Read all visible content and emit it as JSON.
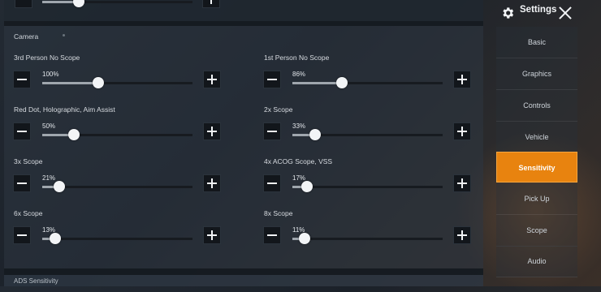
{
  "header": {
    "title": "Settings",
    "close_icon": "close-icon",
    "gear_icon": "gear-icon"
  },
  "section": {
    "title": "Camera"
  },
  "sliders": [
    {
      "label": "3rd Person No Scope",
      "value_text": "100%",
      "percent": 100
    },
    {
      "label": "1st Person No Scope",
      "value_text": "86%",
      "percent": 86
    },
    {
      "label": "Red Dot, Holographic, Aim Assist",
      "value_text": "50%",
      "percent": 50
    },
    {
      "label": "2x Scope",
      "value_text": "33%",
      "percent": 33
    },
    {
      "label": "3x Scope",
      "value_text": "21%",
      "percent": 21
    },
    {
      "label": "4x ACOG Scope, VSS",
      "value_text": "17%",
      "percent": 17
    },
    {
      "label": "6x Scope",
      "value_text": "13%",
      "percent": 13
    },
    {
      "label": "8x Scope",
      "value_text": "11%",
      "percent": 11
    }
  ],
  "nav": {
    "items": [
      {
        "label": "Basic",
        "active": false
      },
      {
        "label": "Graphics",
        "active": false
      },
      {
        "label": "Controls",
        "active": false
      },
      {
        "label": "Vehicle",
        "active": false
      },
      {
        "label": "Sensitivity",
        "active": true
      },
      {
        "label": "Pick Up",
        "active": false
      },
      {
        "label": "Scope",
        "active": false
      },
      {
        "label": "Audio",
        "active": false
      }
    ]
  },
  "bottom": {
    "partial_label": "ADS Sensitivity"
  },
  "colors": {
    "accent": "#e8830f",
    "button_bg": "#12161b",
    "knob": "#f2f4f6"
  }
}
